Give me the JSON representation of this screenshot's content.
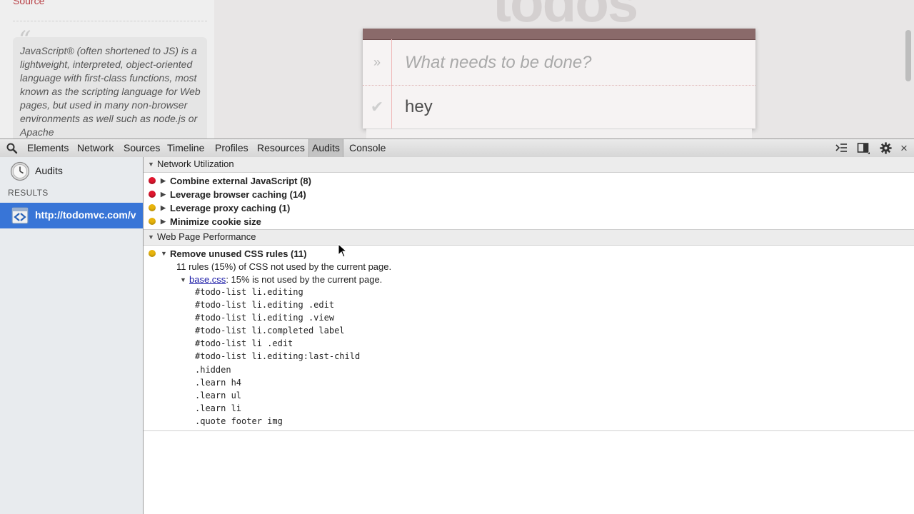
{
  "page": {
    "learn": {
      "source_link": "Source",
      "quote_mark": "“",
      "quote": "JavaScript® (often shortened to JS) is a lightweight, interpreted, object-oriented language with first-class functions, most known as the scripting language for Web pages, but used in many non-browser environments as well such as node.js or Apache"
    },
    "todo": {
      "heading": "todos",
      "placeholder": "What needs to be done?",
      "toggle_all_glyph": "»",
      "check_glyph": "✔",
      "items": [
        {
          "label": "hey"
        }
      ]
    }
  },
  "devtools": {
    "tabs": [
      {
        "label": "Elements"
      },
      {
        "label": "Network"
      },
      {
        "label": "Sources"
      },
      {
        "label": "Timeline"
      },
      {
        "label": "Profiles"
      },
      {
        "label": "Resources"
      },
      {
        "label": "Audits",
        "active": true
      },
      {
        "label": "Console"
      }
    ],
    "close_glyph": "×",
    "sidebar": {
      "audits_label": "Audits",
      "results_label": "RESULTS",
      "result_url": "http://todomvc.com/v"
    },
    "results": {
      "categories": [
        {
          "title": "Network Utilization",
          "rules": [
            {
              "severity": "red",
              "label": "Combine external JavaScript (8)"
            },
            {
              "severity": "red",
              "label": "Leverage browser caching (14)"
            },
            {
              "severity": "yellow",
              "label": "Leverage proxy caching (1)"
            },
            {
              "severity": "yellow",
              "label": "Minimize cookie size"
            }
          ]
        },
        {
          "title": "Web Page Performance",
          "rules": [
            {
              "severity": "yellow",
              "label": "Remove unused CSS rules (11)",
              "expanded": true,
              "summary": "11 rules (15%) of CSS not used by the current page.",
              "file_link": "base.css",
              "file_note": ": 15% is not used by the current page.",
              "selectors": [
                "#todo-list li.editing",
                "#todo-list li.editing .edit",
                "#todo-list li.editing .view",
                "#todo-list li.completed label",
                "#todo-list li .edit",
                "#todo-list li.editing:last-child",
                ".hidden",
                ".learn h4",
                ".learn ul",
                ".learn li",
                ".quote footer img"
              ]
            }
          ]
        }
      ]
    }
  },
  "colors": {
    "selection_blue": "#3875d7",
    "severity_red": "#e0162e",
    "severity_yellow": "#e8b40c",
    "link_color": "#1a1aa6",
    "todo_accent": "#b83f45"
  }
}
